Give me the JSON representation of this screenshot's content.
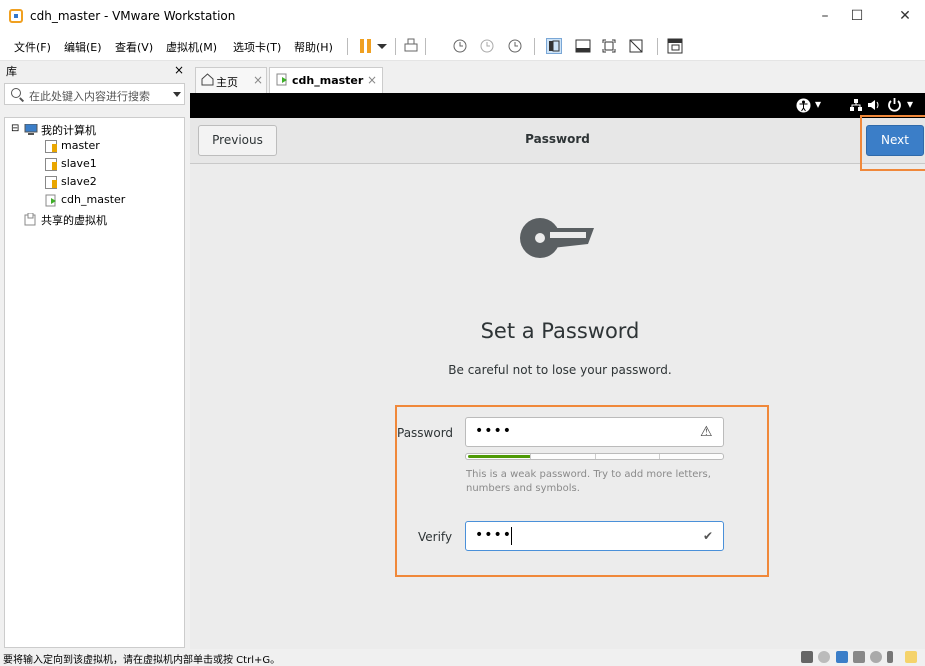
{
  "window": {
    "title": "cdh_master - VMware Workstation",
    "minimize_glyph": "–",
    "maximize_glyph": "☐",
    "close_glyph": "✕"
  },
  "menubar": {
    "items": [
      "文件(F)",
      "编辑(E)",
      "查看(V)",
      "虚拟机(M)",
      "选项卡(T)",
      "帮助(H)"
    ]
  },
  "library": {
    "title": "库",
    "close_glyph": "×",
    "search_placeholder": "在此处键入内容进行搜索",
    "tree": {
      "root_expander": "⊟",
      "root_label": "我的计算机",
      "vms": [
        "master",
        "slave1",
        "slave2",
        "cdh_master"
      ],
      "shared_label": "共享的虚拟机"
    }
  },
  "tabs": [
    {
      "label": "主页",
      "close": "×"
    },
    {
      "label": "cdh_master",
      "close": "×"
    }
  ],
  "vm_topbar": {
    "accessibility_glyph": "⬤",
    "network_glyph": "品",
    "volume_glyph": "🔈",
    "power_glyph": "⏻",
    "dropdown_glyph": "▾"
  },
  "setup": {
    "previous_label": "Previous",
    "header_title": "Password",
    "next_label": "Next",
    "heading": "Set a Password",
    "subheading": "Be careful not to lose your password.",
    "password_label": "Password",
    "password_value": "••••",
    "password_warning_glyph": "⚠",
    "strength_level": 0.25,
    "hint_text": "This is a weak password. Try to add more letters, numbers and symbols.",
    "verify_label": "Verify",
    "verify_value": "••••",
    "verify_check_glyph": "✔"
  },
  "statusbar": {
    "message": "要将输入定向到该虚拟机，请在虚拟机内部单击或按 Ctrl+G。"
  },
  "colors": {
    "accent_blue": "#3b7ec8",
    "highlight_orange": "#f0883a",
    "strength_green": "#4e9a06"
  }
}
